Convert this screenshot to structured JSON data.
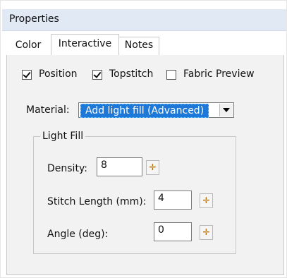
{
  "window": {
    "title": "Properties"
  },
  "tabs": [
    {
      "label": "Color"
    },
    {
      "label": "Interactive"
    },
    {
      "label": "Notes"
    }
  ],
  "options": {
    "position": {
      "label": "Position",
      "checked": true
    },
    "topstitch": {
      "label": "Topstitch",
      "checked": true
    },
    "fabric_preview": {
      "label": "Fabric Preview",
      "checked": false
    }
  },
  "material": {
    "label": "Material:",
    "selected": "Add light fill (Advanced)"
  },
  "light_fill": {
    "title": "Light Fill",
    "density": {
      "label": "Density:",
      "value": "8"
    },
    "stitch_length": {
      "label": "Stitch Length (mm):",
      "value": "4"
    },
    "angle": {
      "label": "Angle (deg):",
      "value": "0"
    }
  },
  "icons": {
    "spin": "crosshair-icon"
  },
  "colors": {
    "selection": "#1e78d7",
    "title_bar": "#e1e9f5",
    "panel": "#f2f2f2",
    "spin_icon": "#b36b00"
  }
}
